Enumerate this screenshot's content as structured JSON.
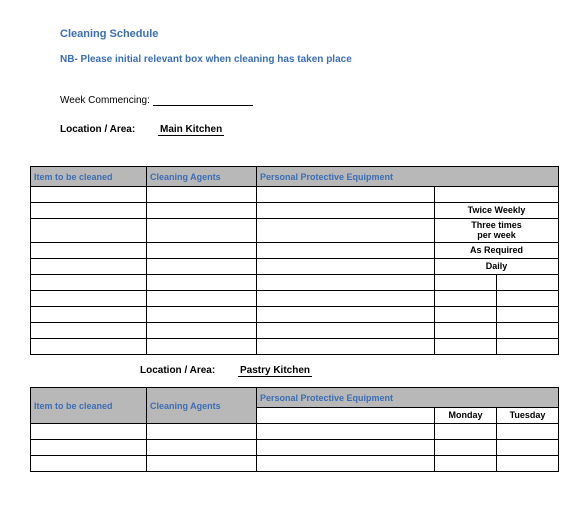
{
  "title": "Cleaning Schedule",
  "nb": "NB- Please initial relevant box when cleaning has taken place",
  "week_label": "Week Commencing:",
  "location_label": "Location / Area:",
  "location1": "Main Kitchen",
  "location2": "Pastry Kitchen",
  "headers": {
    "item": "Item to be cleaned",
    "agents": "Cleaning Agents",
    "ppe": "Personal Protective Equipment"
  },
  "freq": {
    "twice": "Twice Weekly",
    "three1": "Three times",
    "three2": "per week",
    "asreq": "As Required",
    "daily": "Daily"
  },
  "days": {
    "mon": "Monday",
    "tue": "Tuesday"
  }
}
